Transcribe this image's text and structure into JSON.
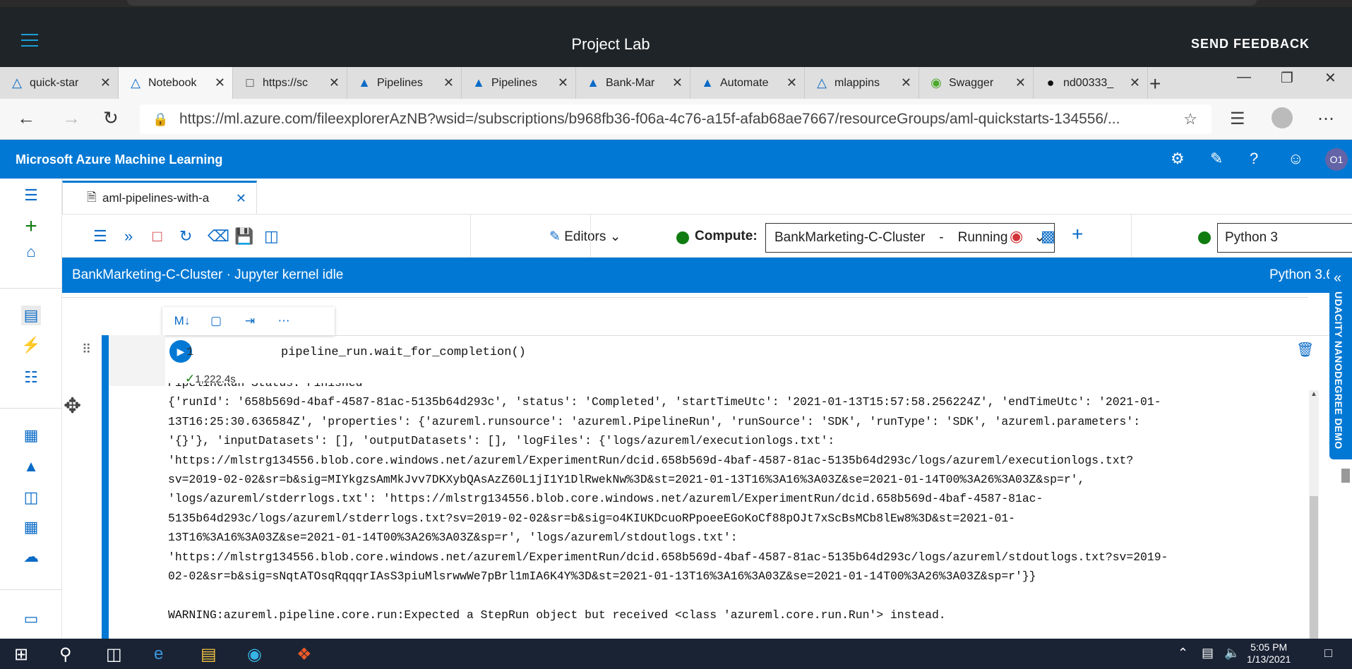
{
  "project": {
    "title": "Project Lab",
    "feedback": "SEND FEEDBACK"
  },
  "tabs": [
    {
      "label": "quick-star",
      "icon": "azure-ml-icon"
    },
    {
      "label": "Notebook",
      "icon": "azure-ml-icon"
    },
    {
      "label": "https://sc",
      "icon": "page-icon"
    },
    {
      "label": "Pipelines",
      "icon": "flask-icon"
    },
    {
      "label": "Pipelines",
      "icon": "flask-icon"
    },
    {
      "label": "Bank-Mar",
      "icon": "flask-icon"
    },
    {
      "label": "Automate",
      "icon": "flask-icon"
    },
    {
      "label": "mlappins",
      "icon": "azure-ml-icon"
    },
    {
      "label": "Swagger",
      "icon": "swagger-icon"
    },
    {
      "label": "nd00333_",
      "icon": "github-icon"
    }
  ],
  "address": {
    "url": "https://ml.azure.com/fileexplorerAzNB?wsid=/subscriptions/b968fb36-f06a-4c76-a15f-afab68ae7667/resourceGroups/aml-quickstarts-134556/..."
  },
  "azure": {
    "brand": "Microsoft Azure Machine Learning",
    "user_initials": "O1"
  },
  "file_tab": {
    "label": "aml-pipelines-with-a"
  },
  "toolbar": {
    "editors_label": "Editors",
    "compute_label": "Compute:",
    "compute_name": "BankMarketing-C-Cluster",
    "compute_sep": "-",
    "compute_state": "Running",
    "kernel": "Python 3"
  },
  "kernel_status": {
    "left": "BankMarketing-C-Cluster · Jupyter kernel idle",
    "right": "Python 3.6"
  },
  "side_panel": {
    "label": "UDACITY NANODEGREE DEMO"
  },
  "cell": {
    "line_number": "1",
    "source": "pipeline_run.wait_for_completion()",
    "timing": "1,222.4s",
    "output": [
      "PipelineRun Status: Finished",
      "{'runId': '658b569d-4baf-4587-81ac-5135b64d293c', 'status': 'Completed', 'startTimeUtc': '2021-01-13T15:57:58.256224Z', 'endTimeUtc': '2021-01-",
      "13T16:25:30.636584Z', 'properties': {'azureml.runsource': 'azureml.PipelineRun', 'runSource': 'SDK', 'runType': 'SDK', 'azureml.parameters':",
      "'{}'}, 'inputDatasets': [], 'outputDatasets': [], 'logFiles': {'logs/azureml/executionlogs.txt':",
      "'https://mlstrg134556.blob.core.windows.net/azureml/ExperimentRun/dcid.658b569d-4baf-4587-81ac-5135b64d293c/logs/azureml/executionlogs.txt?",
      "sv=2019-02-02&sr=b&sig=MIYkgzsAmMkJvv7DKXybQAsAzZ60L1jI1Y1DlRwekNw%3D&st=2021-01-13T16%3A16%3A03Z&se=2021-01-14T00%3A26%3A03Z&sp=r',",
      "'logs/azureml/stderrlogs.txt': 'https://mlstrg134556.blob.core.windows.net/azureml/ExperimentRun/dcid.658b569d-4baf-4587-81ac-",
      "5135b64d293c/logs/azureml/stderrlogs.txt?sv=2019-02-02&sr=b&sig=o4KIUKDcuoRPpoeeEGoKoCf88pOJt7xScBsMCb8lEw8%3D&st=2021-01-",
      "13T16%3A16%3A03Z&se=2021-01-14T00%3A26%3A03Z&sp=r', 'logs/azureml/stdoutlogs.txt':",
      "'https://mlstrg134556.blob.core.windows.net/azureml/ExperimentRun/dcid.658b569d-4baf-4587-81ac-5135b64d293c/logs/azureml/stdoutlogs.txt?sv=2019-",
      "02-02&sr=b&sig=sNqtATOsqRqqqrIAsS3piuMlsrwwWe7pBrl1mIA6K4Y%3D&st=2021-01-13T16%3A16%3A03Z&se=2021-01-14T00%3A26%3A03Z&sp=r'}}",
      "",
      "WARNING:azureml.pipeline.core.run:Expected a StepRun object but received <class 'azureml.core.run.Run'> instead."
    ]
  },
  "taskbar": {
    "time": "5:05 PM",
    "date": "1/13/2021"
  },
  "colors": {
    "azure_blue": "#0078d4",
    "project_bar": "#1f2428",
    "running_green": "#107c10"
  }
}
